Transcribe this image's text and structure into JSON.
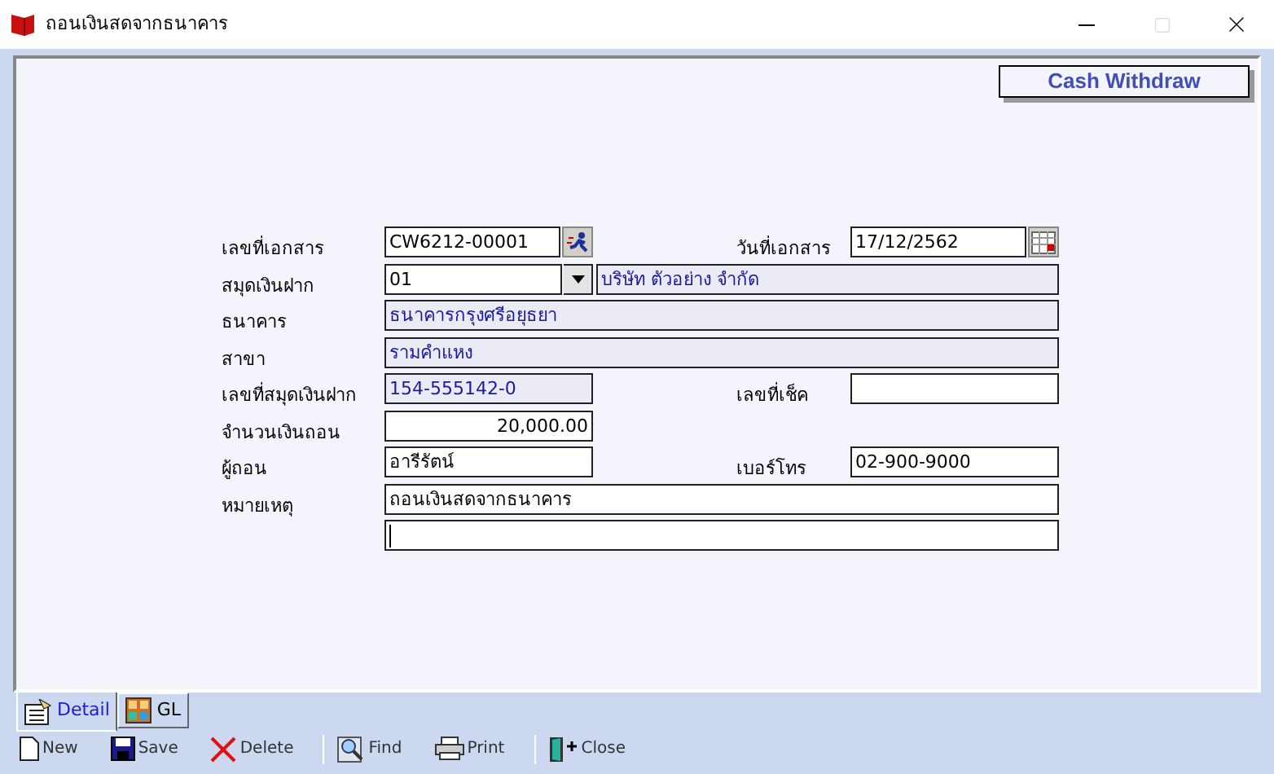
{
  "window": {
    "title": "ถอนเงินสดจากธนาคาร",
    "maximize_disabled": true
  },
  "banner": "Cash Withdraw",
  "rows": [
    {
      "label": "เลขที่เอกสาร",
      "field": {
        "value": "CW6212-00001",
        "kind": "lookup",
        "readonly": false
      },
      "right_label": "วันที่เอกสาร",
      "right_field": {
        "value": "17/12/2562",
        "kind": "date",
        "readonly": false
      }
    },
    {
      "label": "สมุดเงินฝาก",
      "field": {
        "value": "01",
        "kind": "dropdown",
        "readonly": false
      },
      "side_field": {
        "value": "บริษัท ตัวอย่าง จำกัด",
        "readonly": true
      }
    },
    {
      "label": "ธนาคาร",
      "field": {
        "value": "ธนาคารกรุงศรีอยุธยา",
        "kind": "wide",
        "readonly": true
      }
    },
    {
      "label": "สาขา",
      "field": {
        "value": "รามคำแหง",
        "kind": "wide",
        "readonly": true
      }
    },
    {
      "label": "เลขที่สมุดเงินฝาก",
      "field": {
        "value": "154-555142-0",
        "kind": "text",
        "readonly": true
      },
      "right_label": "เลขที่เช็ค",
      "right_field": {
        "kind": "text",
        "readonly": false
      }
    },
    {
      "label": "จำนวนเงินถอน",
      "field": {
        "value": "20,000.00",
        "kind": "number",
        "readonly": false
      }
    },
    {
      "label": "ผู้ถอน",
      "field": {
        "value": "อารีรัตน์",
        "kind": "text",
        "readonly": false
      },
      "right_label": "เบอร์โทร",
      "right_field": {
        "value": "02-900-9000",
        "kind": "text",
        "readonly": false
      }
    },
    {
      "label": "หมายเหตุ",
      "field": {
        "value": "ถอนเงินสดจากธนาคาร",
        "kind": "wide",
        "readonly": false
      }
    },
    {
      "field": {
        "kind": "wide",
        "readonly": false
      }
    }
  ],
  "tabs": [
    {
      "label": "Detail",
      "selected": true,
      "kind": "detail"
    },
    {
      "label": "GL",
      "selected": false,
      "kind": "gl"
    }
  ],
  "toolbar": [
    {
      "label": "New",
      "kind": "new"
    },
    {
      "label": "Save",
      "kind": "save"
    },
    {
      "label": "Delete",
      "kind": "delete"
    },
    {
      "kind": "separator"
    },
    {
      "label": "Find",
      "kind": "find"
    },
    {
      "label": "Print",
      "kind": "print"
    },
    {
      "kind": "separator"
    },
    {
      "label": "Close",
      "kind": "close"
    }
  ]
}
